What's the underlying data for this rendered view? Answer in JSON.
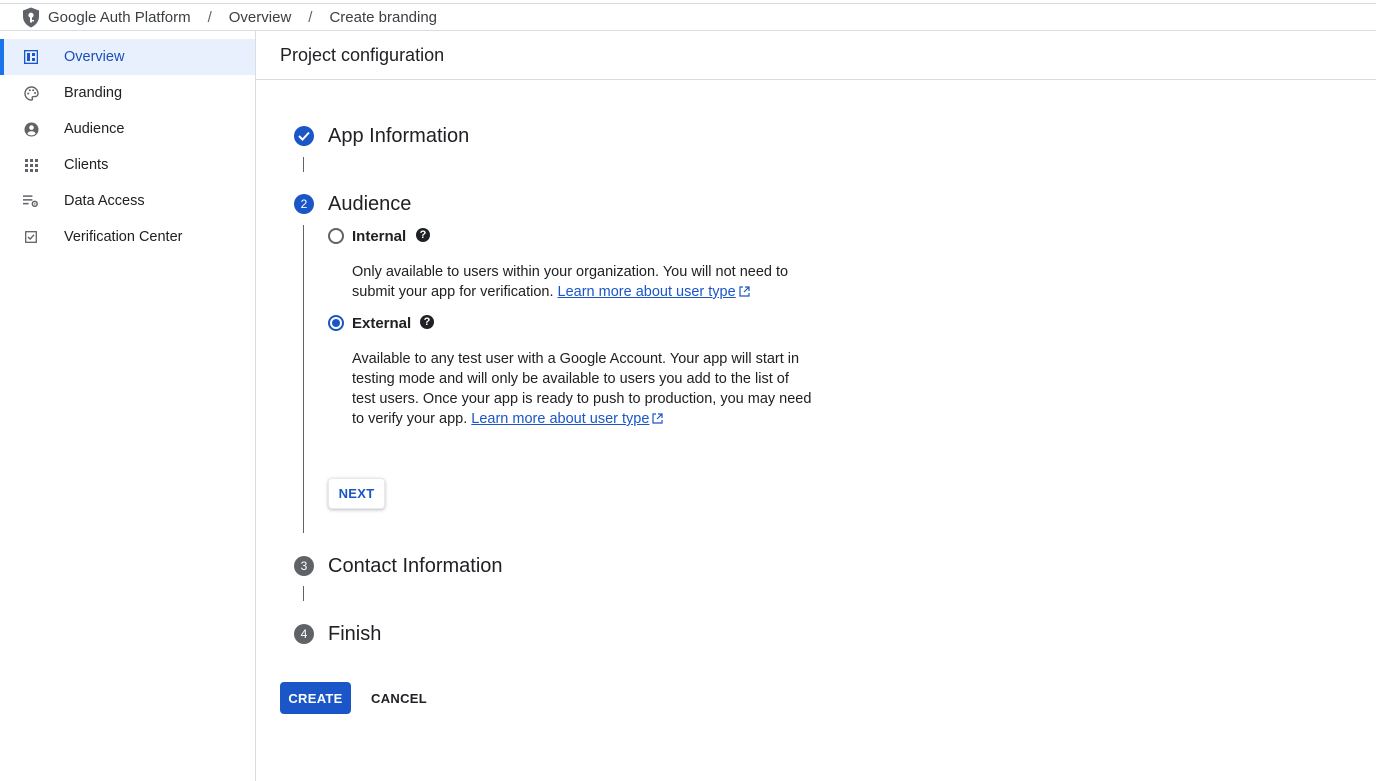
{
  "breadcrumb": {
    "items": [
      "Google Auth Platform",
      "Overview",
      "Create branding"
    ],
    "separator": "/"
  },
  "sidebar": {
    "items": [
      {
        "label": "Overview",
        "icon": "dashboard-icon",
        "active": true
      },
      {
        "label": "Branding",
        "icon": "palette-icon",
        "active": false
      },
      {
        "label": "Audience",
        "icon": "account-circle-icon",
        "active": false
      },
      {
        "label": "Clients",
        "icon": "apps-grid-icon",
        "active": false
      },
      {
        "label": "Data Access",
        "icon": "list-settings-icon",
        "active": false
      },
      {
        "label": "Verification Center",
        "icon": "checkbox-icon",
        "active": false
      }
    ]
  },
  "page": {
    "title": "Project configuration"
  },
  "stepper": {
    "steps": [
      {
        "number": "1",
        "title": "App Information",
        "state": "complete"
      },
      {
        "number": "2",
        "title": "Audience",
        "state": "active"
      },
      {
        "number": "3",
        "title": "Contact Information",
        "state": "pending"
      },
      {
        "number": "4",
        "title": "Finish",
        "state": "pending"
      }
    ]
  },
  "audience": {
    "options": [
      {
        "label": "Internal",
        "help": "?",
        "selected": false,
        "description": "Only available to users within your organization. You will not need to submit your app for verification.",
        "link": "Learn more about user type"
      },
      {
        "label": "External",
        "help": "?",
        "selected": true,
        "description": "Available to any test user with a Google Account. Your app will start in testing mode and will only be available to users you add to the list of test users. Once your app is ready to push to production, you may need to verify your app.",
        "link": "Learn more about user type"
      }
    ],
    "next_label": "NEXT"
  },
  "actions": {
    "create_label": "CREATE",
    "cancel_label": "CANCEL"
  },
  "colors": {
    "accent": "#1a56c8",
    "active_nav_bg": "#e8f0fe",
    "pending_step": "#5f6368"
  }
}
